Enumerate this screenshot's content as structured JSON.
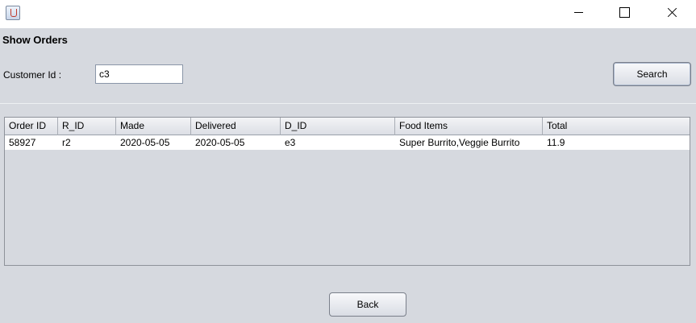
{
  "window": {
    "app_icon": "java-cup-icon"
  },
  "form": {
    "heading": "Show Orders",
    "customer_label": "Customer Id :",
    "customer_value": "c3",
    "search_label": "Search",
    "back_label": "Back"
  },
  "table": {
    "columns": [
      "Order ID",
      "R_ID",
      "Made",
      "Delivered",
      "D_ID",
      "Food Items",
      "Total"
    ],
    "rows": [
      [
        "58927",
        "r2",
        "2020-05-05",
        "2020-05-05",
        "e3",
        "Super Burrito,Veggie Burrito",
        "11.9"
      ]
    ]
  }
}
